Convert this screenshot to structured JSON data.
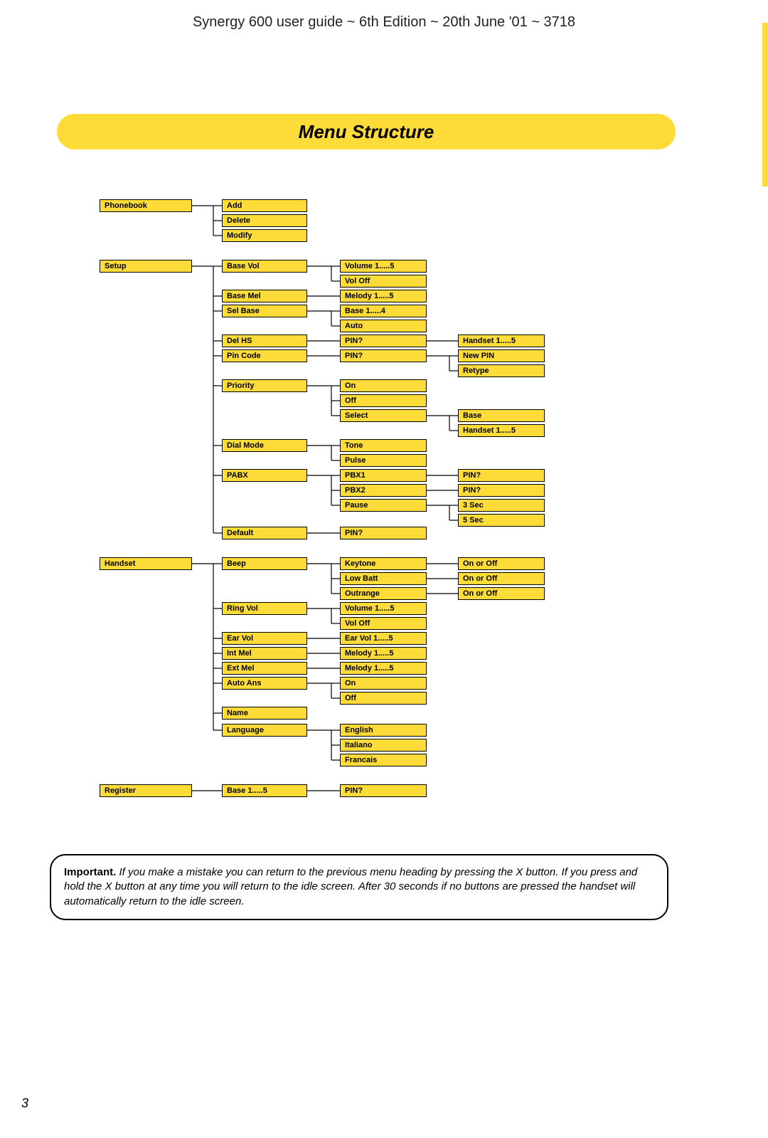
{
  "header": "Synergy 600 user guide ~ 6th Edition ~ 20th June '01 ~ 3718",
  "title": "Menu Structure",
  "page_number": "3",
  "note": {
    "important": "Important.",
    "body": " If you make a mistake you can return to the previous menu heading by pressing the X button. If you press and hold the X button at any time you will return to the idle screen. After 30 seconds if no buttons are pressed the handset will automatically return to the idle screen."
  },
  "boxes": {
    "phonebook": "Phonebook",
    "add": "Add",
    "delete": "Delete",
    "modify": "Modify",
    "setup": "Setup",
    "basevol": "Base Vol",
    "volume15": "Volume 1.....5",
    "voloff": "Vol Off",
    "basemel": "Base Mel",
    "melody15a": "Melody 1.....5",
    "selbase": "Sel Base",
    "base14": "Base 1.....4",
    "auto": "Auto",
    "delhs": "Del HS",
    "pin1": "PIN?",
    "handset15a": "Handset 1.....5",
    "pincode": "Pin Code",
    "pin2": "PIN?",
    "newpin": "New PIN",
    "retype": "Retype",
    "priority": "Priority",
    "on1": "On",
    "off1": "Off",
    "select": "Select",
    "base": "Base",
    "handset15b": "Handset 1.....5",
    "dialmode": "Dial Mode",
    "tone": "Tone",
    "pulse": "Pulse",
    "pabx": "PABX",
    "pbx1": "PBX1",
    "pin3": "PIN?",
    "pbx2": "PBX2",
    "pin4": "PIN?",
    "pause": "Pause",
    "sec3": "3 Sec",
    "sec5": "5 Sec",
    "default": "Default",
    "pin5": "PIN?",
    "handset": "Handset",
    "beep": "Beep",
    "keytone": "Keytone",
    "onoroff1": "On or Off",
    "lowbatt": "Low Batt",
    "onoroff2": "On or Off",
    "outrange": "Outrange",
    "onoroff3": "On or Off",
    "ringvol": "Ring Vol",
    "volume15b": "Volume 1.....5",
    "voloff2": "Vol Off",
    "earvol": "Ear Vol",
    "earvol15": "Ear Vol 1.....5",
    "intmel": "Int Mel",
    "melody15b": "Melody 1.....5",
    "extmel": "Ext Mel",
    "melody15c": "Melody 1.....5",
    "autoans": "Auto Ans",
    "on2": "On",
    "off2": "Off",
    "name": "Name",
    "language": "Language",
    "english": "English",
    "italiano": "Italiano",
    "francais": "Francais",
    "register": "Register",
    "base15": "Base 1.....5",
    "pin6": "PIN?"
  }
}
